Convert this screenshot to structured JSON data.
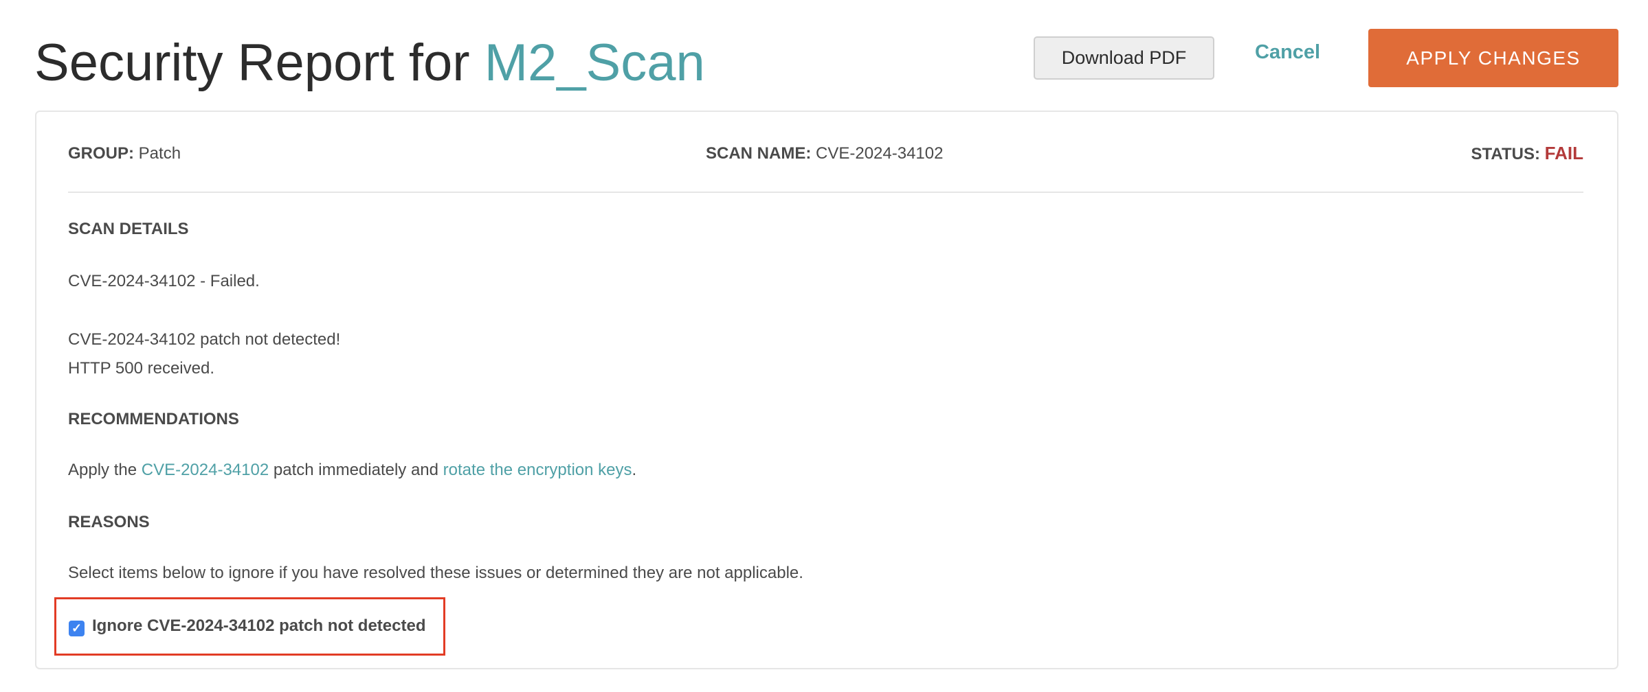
{
  "header": {
    "title_prefix": "Security Report for ",
    "title_target": "M2_Scan",
    "download_pdf_label": "Download PDF",
    "cancel_label": "Cancel",
    "apply_label": "APPLY CHANGES"
  },
  "summary": {
    "group_label": "GROUP:",
    "group_value": "Patch",
    "scan_name_label": "SCAN NAME:",
    "scan_name_value": "CVE-2024-34102",
    "status_label": "STATUS:",
    "status_value": "FAIL"
  },
  "scan_details": {
    "heading": "SCAN DETAILS",
    "line1": "CVE-2024-34102 - Failed.",
    "line2": "CVE-2024-34102 patch not detected!",
    "line3": "HTTP 500 received."
  },
  "recommendations": {
    "heading": "RECOMMENDATIONS",
    "text_before": "Apply the ",
    "link1": "CVE-2024-34102",
    "text_middle": " patch immediately and ",
    "link2": "rotate the encryption keys",
    "text_after": "."
  },
  "reasons": {
    "heading": "REASONS",
    "instructions": "Select items below to ignore if you have resolved these issues or determined they are not applicable.",
    "items": [
      {
        "label": "Ignore CVE-2024-34102 patch not detected",
        "checked": true
      }
    ]
  },
  "colors": {
    "accent": "#4fa0a6",
    "primary_button": "#e06c38",
    "fail": "#b33a3a",
    "highlight_box": "#e23c25",
    "checkbox": "#3d83f0"
  }
}
